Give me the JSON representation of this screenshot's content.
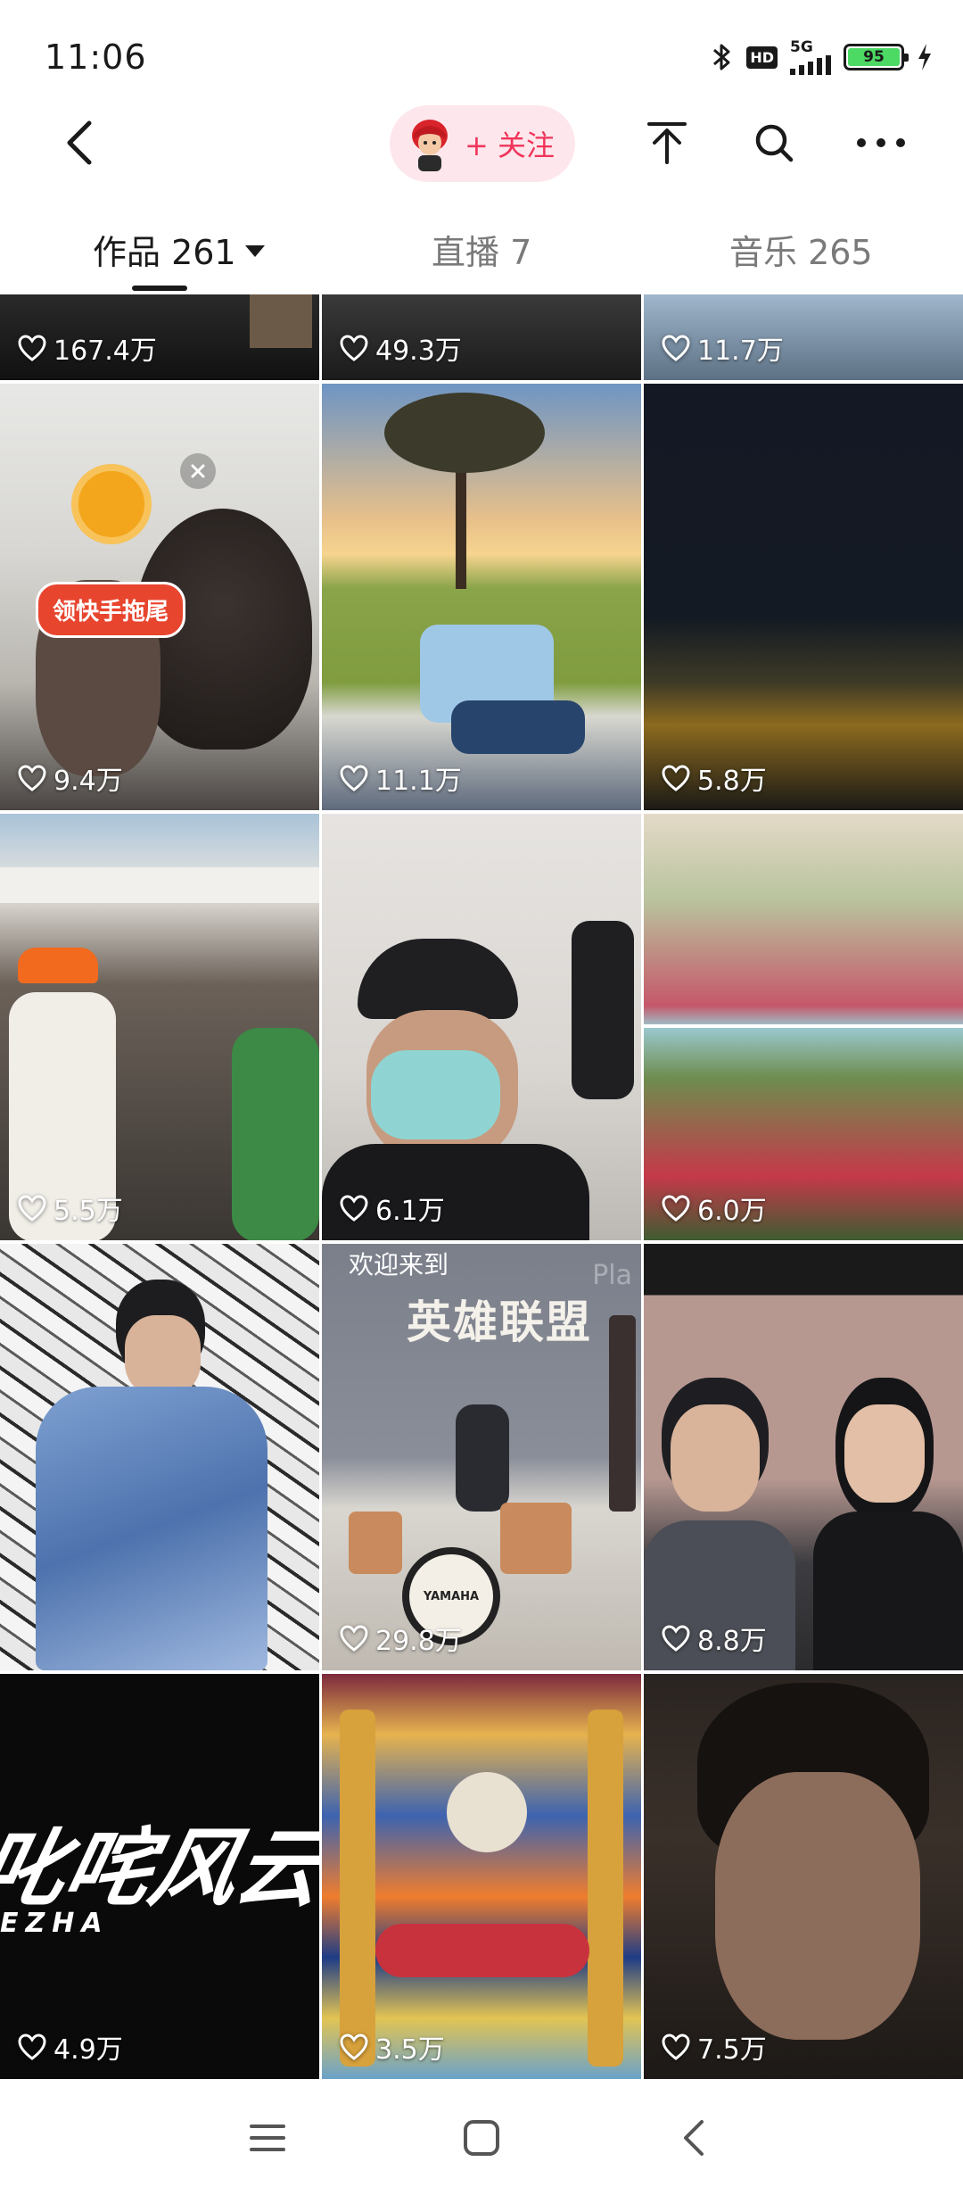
{
  "status_bar": {
    "time": "11:06",
    "hd": "HD",
    "network": "5G",
    "battery": "95",
    "icons": [
      "bluetooth-icon",
      "hd-icon",
      "signal-icon",
      "battery-icon",
      "charging-icon"
    ]
  },
  "header": {
    "follow_label": "+ 关注",
    "icons": [
      "back-icon",
      "scroll-to-top-icon",
      "search-icon",
      "more-icon"
    ]
  },
  "tabs": [
    {
      "label": "作品 261",
      "active": true
    },
    {
      "label": "直播 7",
      "active": false
    },
    {
      "label": "音乐 265",
      "active": false
    }
  ],
  "overlay": {
    "promo_label": "领快手拖尾",
    "icon": "close-icon"
  },
  "videos": [
    {
      "likes": "167.4万"
    },
    {
      "likes": "49.3万"
    },
    {
      "likes": "11.7万"
    },
    {
      "likes": "9.4万"
    },
    {
      "likes": "11.1万"
    },
    {
      "likes": "5.8万"
    },
    {
      "likes": "5.5万"
    },
    {
      "likes": "6.1万"
    },
    {
      "likes": "6.0万"
    },
    {
      "likes": "",
      "caption": "欢迎来到",
      "title": "英雄联盟",
      "corner": "Pla",
      "drum_brand": "YAMAHA"
    },
    {
      "likes": "29.8万"
    },
    {
      "likes": "8.8万"
    },
    {
      "likes": "4.9万",
      "art": "叱咤风云",
      "art_sub": "EZHA"
    },
    {
      "likes": "3.5万"
    },
    {
      "likes": "7.5万"
    }
  ],
  "nav": {
    "icons": [
      "menu-icon",
      "home-icon",
      "back-icon"
    ]
  }
}
